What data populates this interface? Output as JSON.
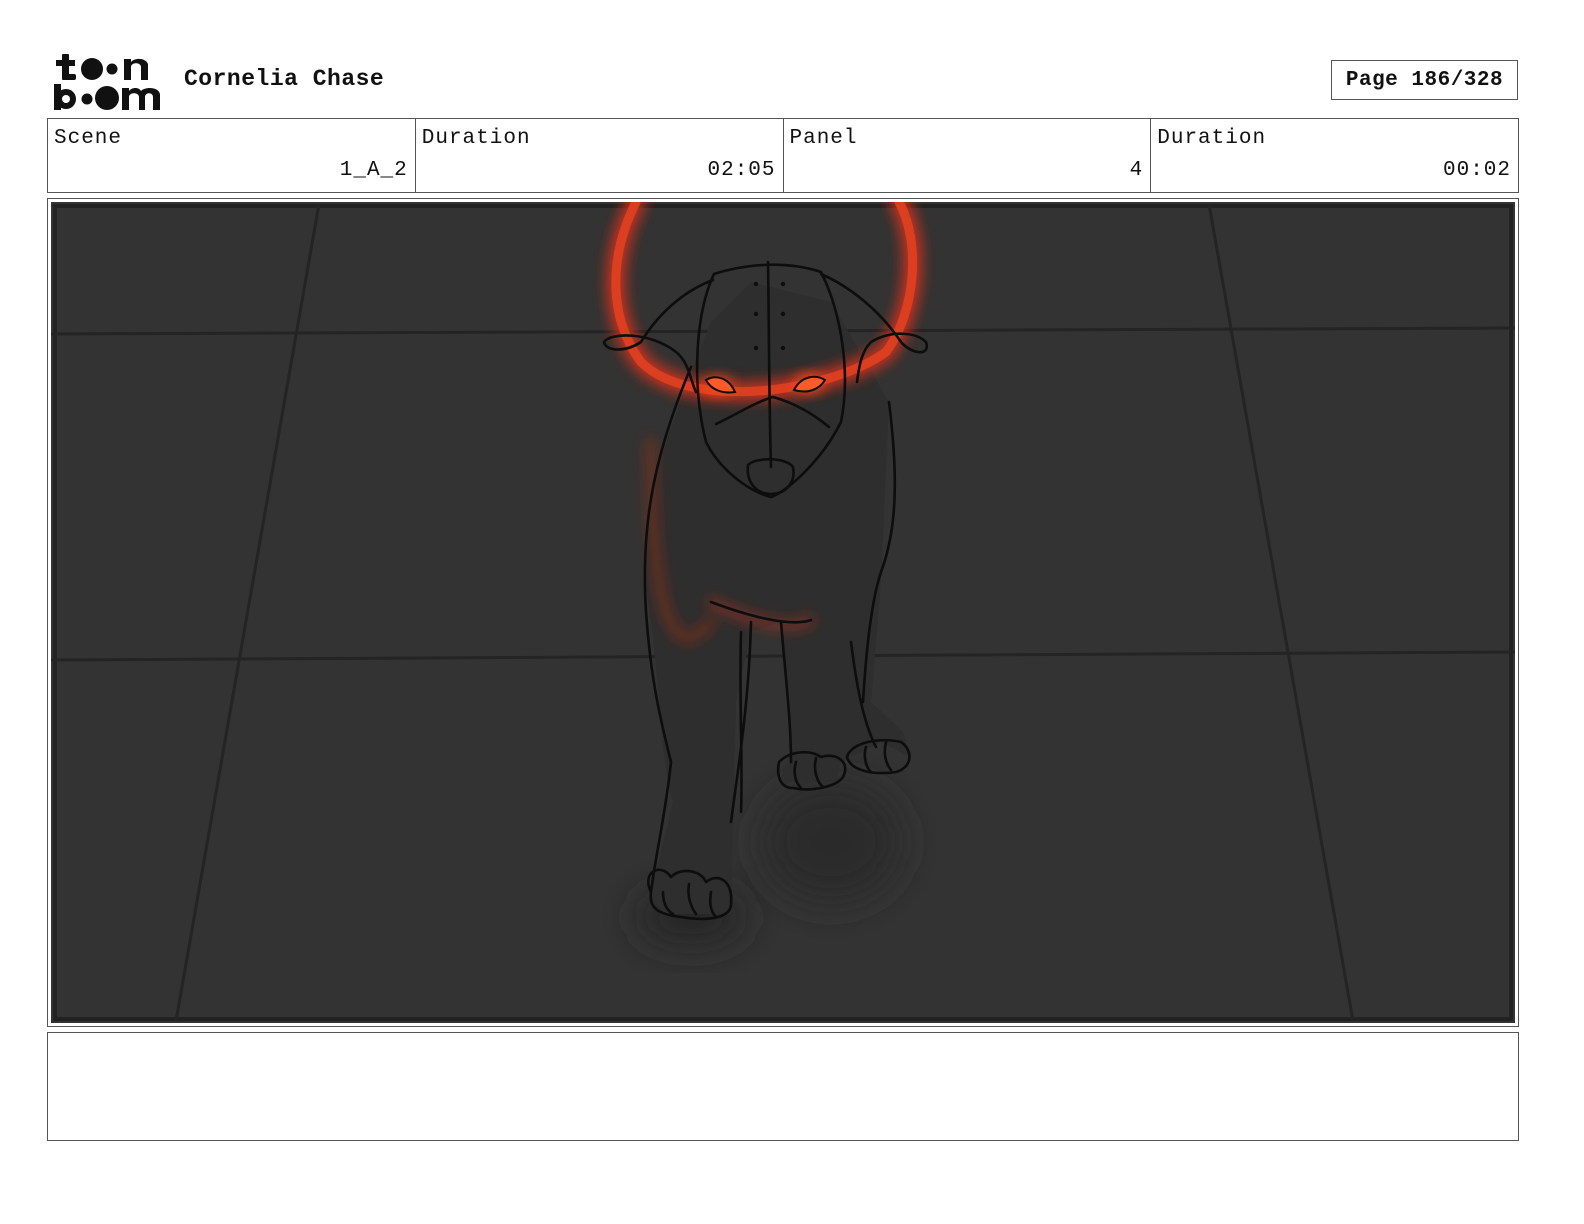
{
  "header": {
    "project_title": "Cornelia Chase",
    "page_label": "Page 186/328"
  },
  "info": {
    "scene_label": "Scene",
    "scene_value": "1_A_2",
    "scene_duration_label": "Duration",
    "scene_duration_value": "02:05",
    "panel_label": "Panel",
    "panel_value": "4",
    "panel_duration_label": "Duration",
    "panel_duration_value": "00:02"
  },
  "panel": {
    "background_color": "#333333",
    "glow_color": "#d8321a"
  },
  "notes": {
    "text": ""
  }
}
